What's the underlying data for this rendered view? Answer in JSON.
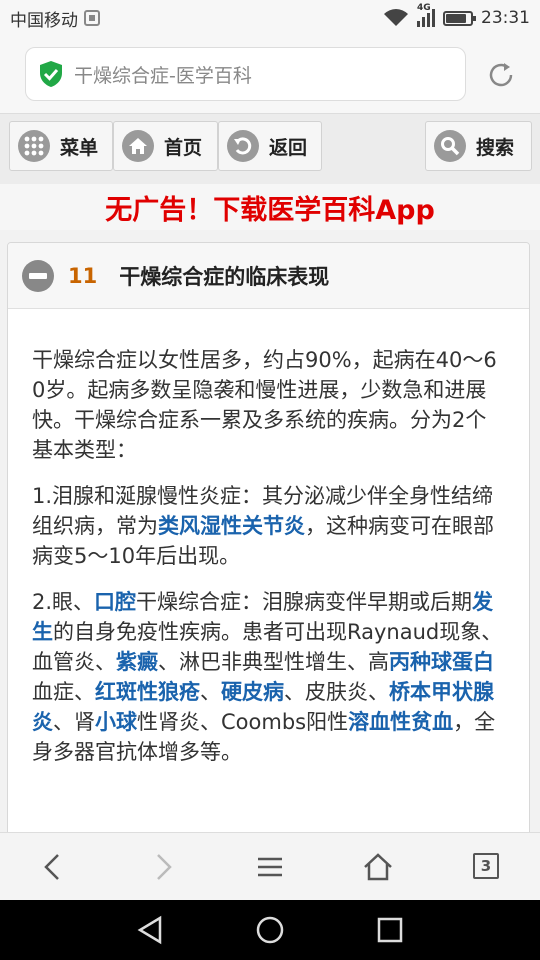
{
  "status_bar": {
    "carrier": "中国移动",
    "network": "4G",
    "time": "23:31",
    "battery_level": 0.85
  },
  "address_bar": {
    "url_title": "干燥综合症-医学百科",
    "icon_secure": "green-shield-check-icon",
    "icon_refresh": "refresh-icon"
  },
  "nav": {
    "menu_label": "菜单",
    "home_label": "首页",
    "back_label": "返回",
    "search_label": "搜索"
  },
  "ad_banner": {
    "text": "无广告！下载医学百科App",
    "color": "#e00000"
  },
  "section": {
    "number": "11",
    "title": "干燥综合症的临床表现",
    "paragraphs": [
      {
        "p1_a": "干燥综合症以女性居多，约占90%，起病在40～60岁。起病多数呈隐袭和慢性进展，少数急和进展快。干燥综合症系一累及多系统的疾病。分为2个基本类型："
      },
      {
        "p2_a": "1.泪腺和涎腺慢性炎症：其分泌减少伴全身性结缔组织病，常为",
        "p2_link1": "类风湿性关节炎",
        "p2_b": "，这种病变可在眼部病变5～10年后出现。"
      },
      {
        "p3_a": "2.眼、",
        "p3_link1": "口腔",
        "p3_b": "干燥综合症：泪腺病变伴早期或后期",
        "p3_link2": "发生",
        "p3_c": "的自身免疫性疾病。患者可出现Raynaud现象、血管炎、",
        "p3_link3": "紫癜",
        "p3_d": "、淋巴非典型性增生、高",
        "p3_link4": "丙种球蛋白",
        "p3_e": "血症、",
        "p3_link5": "红斑性狼疮",
        "p3_f": "、",
        "p3_link6": "硬皮病",
        "p3_g": "、皮肤炎、",
        "p3_link7": "桥本甲状腺炎",
        "p3_h": "、肾",
        "p3_link8": "小球",
        "p3_i": "性肾炎、Coombs阳性",
        "p3_link9": "溶血性贫血",
        "p3_j": "，全身多器官抗体增多等。"
      }
    ],
    "link_color": "#1a63ad"
  },
  "toolbar": {
    "tab_count": "3"
  }
}
